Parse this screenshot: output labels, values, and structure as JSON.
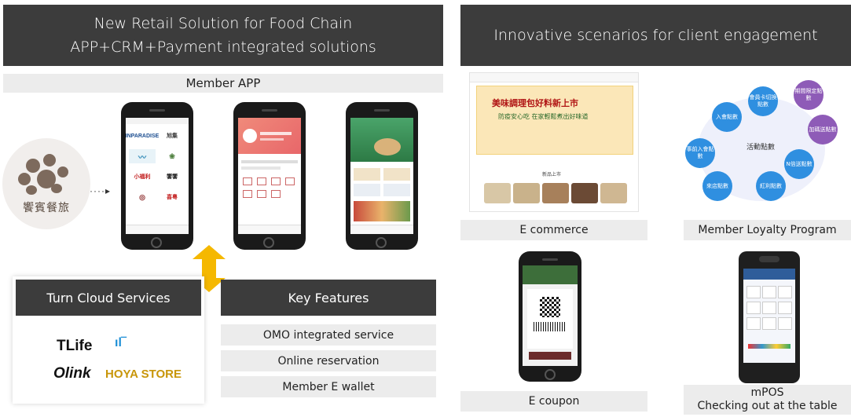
{
  "left_header": {
    "line1": "New Retail Solution for Food Chain",
    "line2": "APP+CRM+Payment integrated solutions"
  },
  "right_header": {
    "title": "Innovative scenarios for client engagement"
  },
  "member_app": {
    "label": "Member APP"
  },
  "brand_logo": {
    "text": "饗賓餐旅"
  },
  "phone1": {
    "cells": [
      "INPARADISE",
      "旭集",
      "",
      "",
      "小福利",
      "饗饗",
      "",
      "喜粵"
    ]
  },
  "turn_cloud": {
    "title": "Turn Cloud Services",
    "brands": [
      "TLife",
      "Olink",
      "HOYA STORE"
    ]
  },
  "key_features": {
    "title": "Key Features",
    "items": [
      "OMO integrated service",
      "Online reservation",
      "Member E wallet"
    ]
  },
  "ecommerce": {
    "banner_title": "美味調理包好料新上市",
    "banner_sub": "防疫安心吃 在家輕鬆煮出好味道",
    "section_label": "新品上市",
    "caption": "E commerce"
  },
  "loyalty": {
    "center": "活動點數",
    "nodes": [
      "會員卡切換點數",
      "期間限定點數",
      "加碼送點數",
      "N倍送點數",
      "紅利點數",
      "來店點數",
      "事前入會點數",
      "入會點數"
    ],
    "caption": "Member Loyalty Program"
  },
  "ecoupon": {
    "caption": "E coupon"
  },
  "mpos": {
    "line1": "mPOS",
    "line2": "Checking out at the table"
  },
  "colors": {
    "header_bg": "#3c3c3c",
    "bar_bg": "#ececec",
    "arrow": "#f5b800",
    "node_blue": "#2f8fe0",
    "node_purple": "#8e5bb7"
  }
}
